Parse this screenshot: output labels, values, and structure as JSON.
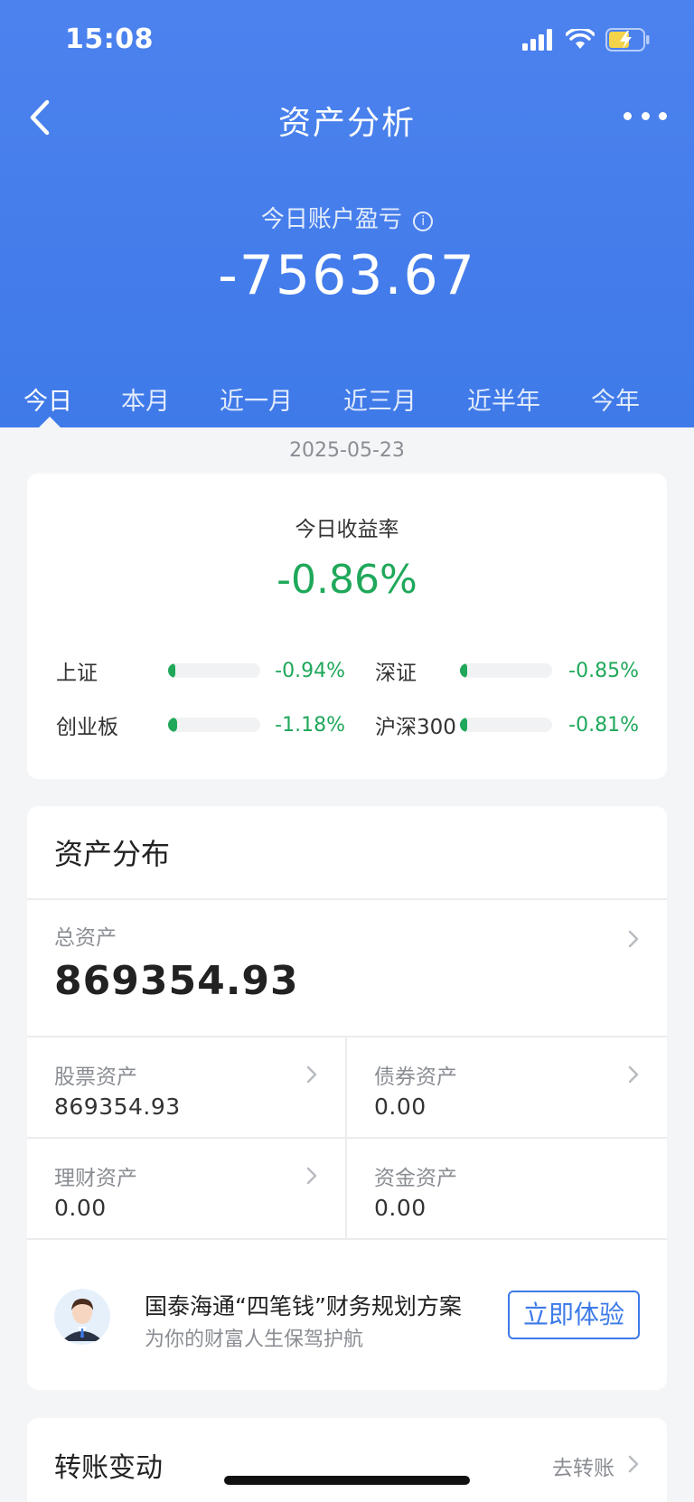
{
  "status_bar": {
    "time": "15:08"
  },
  "nav": {
    "title": "资产分析"
  },
  "summary": {
    "label": "今日账户盈亏",
    "value": "-7563.67",
    "info_glyph": "i"
  },
  "tabs": [
    {
      "label": "今日",
      "active": true
    },
    {
      "label": "本月",
      "active": false
    },
    {
      "label": "近一月",
      "active": false
    },
    {
      "label": "近三月",
      "active": false
    },
    {
      "label": "近半年",
      "active": false
    },
    {
      "label": "今年",
      "active": false
    }
  ],
  "date": "2025-05-23",
  "returns": {
    "title": "今日收益率",
    "value": "-0.86%",
    "indices": [
      {
        "name": "上证",
        "change": "-0.94%",
        "fill_pct": 8
      },
      {
        "name": "深证",
        "change": "-0.85%",
        "fill_pct": 8
      },
      {
        "name": "创业板",
        "change": "-1.18%",
        "fill_pct": 10
      },
      {
        "name": "沪深300",
        "change": "-0.81%",
        "fill_pct": 8
      }
    ]
  },
  "assets": {
    "title": "资产分布",
    "total_label": "总资产",
    "total_value": "869354.93",
    "stock_label": "股票资产",
    "stock_value": "869354.93",
    "bond_label": "债券资产",
    "bond_value": "0.00",
    "wealth_label": "理财资产",
    "wealth_value": "0.00",
    "cash_label": "资金资产",
    "cash_value": "0.00"
  },
  "promo": {
    "title": "国泰海通“四笔钱”财务规划方案",
    "subtitle": "为你的财富人生保驾护航",
    "button": "立即体验"
  },
  "transfer": {
    "title": "转账变动",
    "link": "去转账"
  },
  "colors": {
    "primary": "#4c82ee",
    "down_green": "#1fa85a",
    "button_blue": "#3d7ae8"
  }
}
